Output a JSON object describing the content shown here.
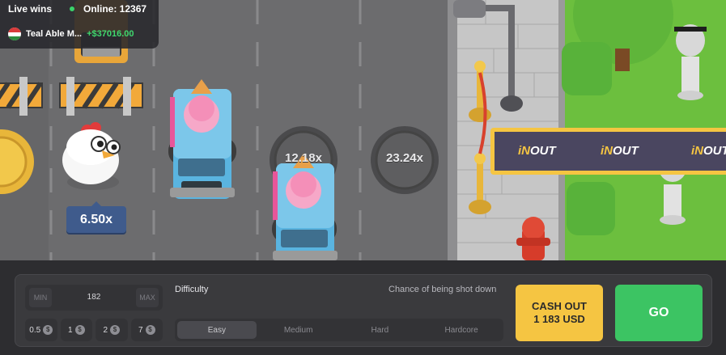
{
  "live": {
    "title": "Live wins",
    "online": "Online: 12367",
    "winner_name": "Teal Able M...",
    "winner_amount": "+$37016.00"
  },
  "game": {
    "chicken_multiplier": "6.50x",
    "manhole_1": "12.18x",
    "manhole_2": "23.24x",
    "banner_logo_in": "iN",
    "banner_logo_out": "OUT"
  },
  "controls": {
    "bet_min": "MIN",
    "bet_max": "MAX",
    "bet_value": "182",
    "chips": [
      {
        "value": "0.5",
        "icon": "coin-icon"
      },
      {
        "value": "1",
        "icon": "coin-icon"
      },
      {
        "value": "2",
        "icon": "coin-icon"
      },
      {
        "value": "7",
        "icon": "coin-icon"
      }
    ],
    "coin_symbol": "$",
    "difficulty_label": "Difficulty",
    "chance_label": "Chance of being shot down",
    "difficulties": [
      "Easy",
      "Medium",
      "Hard",
      "Hardcore"
    ],
    "selected_difficulty": "Easy",
    "cashout_line1": "CASH OUT",
    "cashout_line2": "1 183 USD",
    "go_label": "GO"
  },
  "colors": {
    "road": "#6e6e70",
    "grass": "#6cbf3e",
    "sidewalk": "#bfbfbf",
    "banner": "#4a4660",
    "accent_yellow": "#f5c542",
    "accent_green": "#3cc463",
    "multiplier_blue": "#3f5b8c"
  }
}
